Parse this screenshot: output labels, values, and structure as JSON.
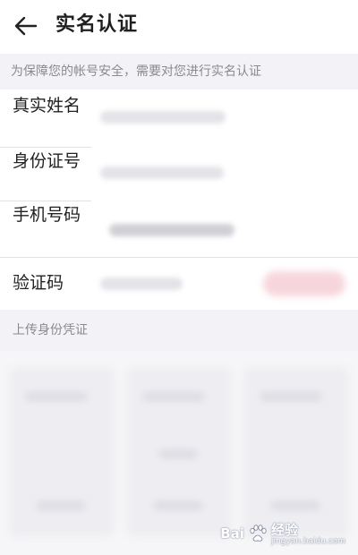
{
  "header": {
    "title": "实名认证",
    "back_icon": "arrow-left-icon"
  },
  "notice": {
    "text": "为保障您的帐号安全，需要对您进行实名认证"
  },
  "form": {
    "fields": [
      {
        "label": "真实姓名"
      },
      {
        "label": "身份证号"
      },
      {
        "label": "手机号码"
      },
      {
        "label": "验证码"
      }
    ]
  },
  "upload": {
    "section_title": "上传身份凭证"
  },
  "watermark": {
    "logo": "baidu-paw-icon",
    "text": "Bai",
    "brand": "经验",
    "url": "jingyan.baidu.com"
  },
  "colors": {
    "text": "#1f1f1f",
    "muted": "#8a8a8f",
    "section_bg": "#f3f3f7",
    "accent_send": "#f6d6dc"
  }
}
